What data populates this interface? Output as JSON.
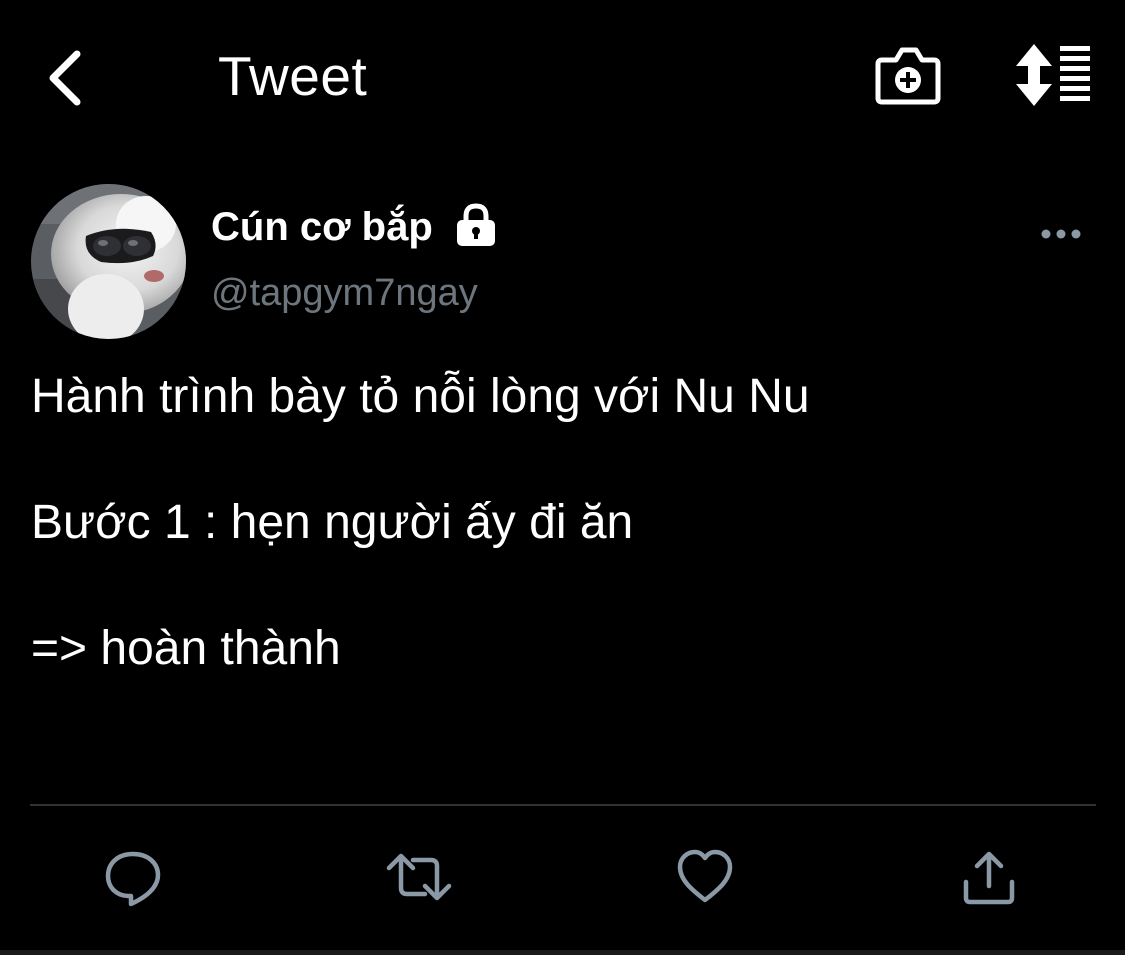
{
  "header": {
    "title": "Tweet",
    "back_icon": "chevron-left-icon",
    "camera_icon": "camera-plus-icon",
    "sort_icon": "sort-list-icon"
  },
  "tweet": {
    "author": {
      "display_name": "Cún cơ bắp",
      "handle": "@tapgym7ngay",
      "protected_icon": "lock-icon"
    },
    "more_icon": "more-horizontal-icon",
    "lines": [
      "Hành trình bày tỏ nỗi lòng với Nu Nu",
      "Bước 1 : hẹn người ấy đi ăn",
      "=> hoàn thành"
    ]
  },
  "actions": [
    {
      "name": "reply",
      "icon": "reply-icon"
    },
    {
      "name": "retweet",
      "icon": "retweet-icon"
    },
    {
      "name": "like",
      "icon": "heart-icon"
    },
    {
      "name": "share",
      "icon": "share-icon"
    }
  ],
  "colors": {
    "background": "#000000",
    "text_primary": "#ffffff",
    "text_secondary": "#6e767d",
    "icon_secondary": "#8b98a5",
    "divider": "#2f3336"
  }
}
